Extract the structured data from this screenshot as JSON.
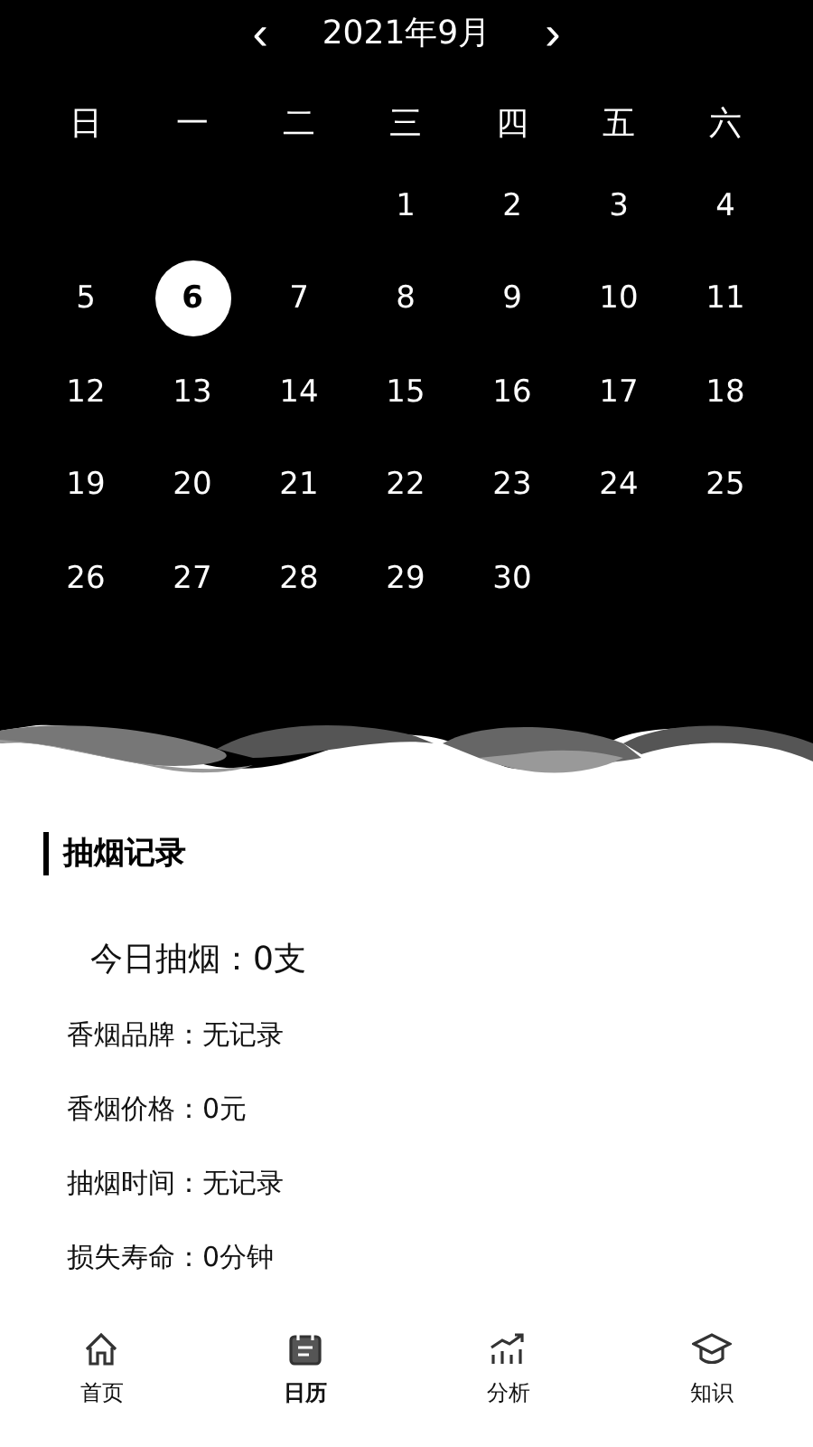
{
  "calendar": {
    "prev": "‹",
    "title": "2021年9月",
    "next": "›",
    "weekdays": [
      "日",
      "一",
      "二",
      "三",
      "四",
      "五",
      "六"
    ],
    "weeks": [
      [
        {
          "day": "1",
          "selected": false
        },
        {
          "day": "2",
          "selected": false
        },
        {
          "day": "3",
          "selected": false
        },
        {
          "day": "4",
          "selected": false
        }
      ],
      [
        {
          "day": "5",
          "selected": false
        },
        {
          "day": "6",
          "selected": true
        },
        {
          "day": "7",
          "selected": false
        },
        {
          "day": "8",
          "selected": false
        },
        {
          "day": "9",
          "selected": false
        },
        {
          "day": "10",
          "selected": false
        },
        {
          "day": "11",
          "selected": false
        }
      ],
      [
        {
          "day": "12",
          "selected": false
        },
        {
          "day": "13",
          "selected": false
        },
        {
          "day": "14",
          "selected": false
        },
        {
          "day": "15",
          "selected": false
        },
        {
          "day": "16",
          "selected": false
        },
        {
          "day": "17",
          "selected": false
        },
        {
          "day": "18",
          "selected": false
        }
      ],
      [
        {
          "day": "19",
          "selected": false
        },
        {
          "day": "20",
          "selected": false
        },
        {
          "day": "21",
          "selected": false
        },
        {
          "day": "22",
          "selected": false
        },
        {
          "day": "23",
          "selected": false
        },
        {
          "day": "24",
          "selected": false
        },
        {
          "day": "25",
          "selected": false
        }
      ],
      [
        {
          "day": "26",
          "selected": false
        },
        {
          "day": "27",
          "selected": false
        },
        {
          "day": "28",
          "selected": false
        },
        {
          "day": "29",
          "selected": false
        },
        {
          "day": "30",
          "selected": false
        }
      ]
    ]
  },
  "record": {
    "title": "抽烟记录",
    "items": [
      {
        "kind": "summary",
        "text": "今日抽烟：0支"
      },
      {
        "kind": "detail",
        "text": "香烟品牌：无记录"
      },
      {
        "kind": "detail",
        "text": "香烟价格：0元"
      },
      {
        "kind": "detail",
        "text": "抽烟时间：无记录"
      },
      {
        "kind": "detail",
        "text": "损失寿命：0分钟"
      }
    ]
  },
  "nav": [
    {
      "kind": "home",
      "label": "首页",
      "selected": false
    },
    {
      "kind": "calendar",
      "label": "日历",
      "selected": true
    },
    {
      "kind": "chart",
      "label": "分析",
      "selected": false
    },
    {
      "kind": "cap",
      "label": "知识",
      "selected": false
    }
  ]
}
